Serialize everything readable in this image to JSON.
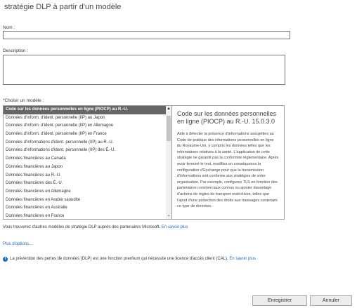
{
  "title": "stratégie DLP à partir d'un modèle",
  "name_label": "Nom :",
  "name_value": "",
  "description_label": "Description :",
  "description_value": "",
  "template_label": "*Choisir un modèle :",
  "templates": [
    "Code sur les données personnelles en ligne (PIOCP) au R.-U.",
    "Données d'inform. d'ident. personnelle (IIP) au Japon",
    "Données d'inform. d'ident. personnelle (IIP) en Allemagne",
    "Données d'inform. d'ident. personnelle (IIP) en France",
    "Données d'informations d'ident. personnelle (IIP) au R.-U.",
    "Données d'informations d'ident. personnelle (IIP) des É.-U.",
    "Données financières au Canada",
    "Données financières au Japon",
    "Données financières au R.-U.",
    "Données financières des É.-U.",
    "Données financières en Allemagne",
    "Données financières en Arabie saoudite",
    "Données financières en Australie",
    "Données financières en France"
  ],
  "selected_index": 0,
  "detail": {
    "title": "Code sur les données personnelles en ligne (PIOCP) au R.-U.  15.0.3.0",
    "description": "Aide à détecter la présence d'informations assujetties au Code de pratique des informations personnelles en ligne du Royaume-Uni, y compris les données telles que les informations relatives à la santé. L'application de cette stratégie ne garantit pas la conformité réglementaire. Après avoir terminé le test, modifiez en conséquence la configuration d'Exchange pour que la transmission d'informations soit conforme aux stratégies de votre organisation. Par exemple, configurez TLS en fonction des partenaires commerciaux connus ou ajouter davantage d'actions de règles de transport restrictives, telles que l'ajout d'une protection des droits aux messages contenant ce type de données."
  },
  "partner_note": "Vous trouverez d'autres modèles de stratégie DLP auprès des partenaires Microsoft.",
  "partner_link": "En savoir plus",
  "more_options": "Plus d'options...",
  "info_text": "La prévention des pertes de données (DLP) est une fonction premium qui nécessite une licence d'accès client (CAL).",
  "info_link": "En savoir plus",
  "buttons": {
    "save": "Enregistrer",
    "cancel": "Annuler"
  },
  "icons": {
    "info": "info-icon",
    "scroll_up": "chevron-up-icon",
    "scroll_down": "chevron-down-icon"
  },
  "colors": {
    "selection": "#666666",
    "link": "#1e6bb8"
  }
}
